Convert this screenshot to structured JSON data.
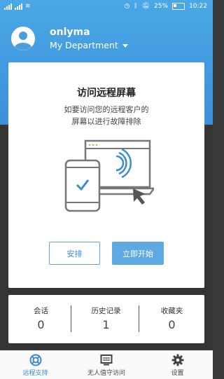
{
  "status_bar": {
    "left_indicators": "ıll ıll",
    "battery": "25%",
    "time": "10:22"
  },
  "account": {
    "name": "onlyma",
    "department": "My Department"
  },
  "card": {
    "title": "访问远程屏幕",
    "desc_line1": "如要访问您的远程客户的",
    "desc_line2": "屏幕以进行故障排除",
    "btn_arrange": "安排",
    "btn_start": "立即开始"
  },
  "stats": [
    {
      "label": "会话",
      "value": "0"
    },
    {
      "label": "历史记录",
      "value": "1"
    },
    {
      "label": "收藏夹",
      "value": "0"
    }
  ],
  "nav": [
    {
      "label": "远程支持",
      "icon": "lifebuoy-icon",
      "active": true
    },
    {
      "label": "无人值守访问",
      "icon": "monitor-icon",
      "active": false
    },
    {
      "label": "设置",
      "icon": "gear-icon",
      "active": false
    }
  ],
  "colors": {
    "header": "#4aa8e6",
    "accent": "#3e8bd0",
    "dark_bg": "#353535"
  }
}
